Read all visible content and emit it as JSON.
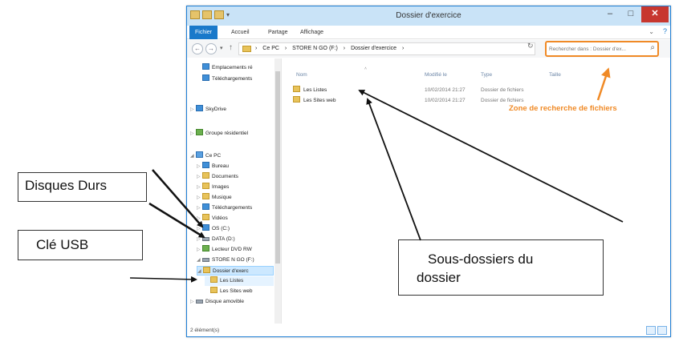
{
  "window": {
    "title": "Dossier d'exercice",
    "minimize": "–",
    "maximize": "□",
    "close": "✕"
  },
  "ribbon": {
    "tabs": [
      "Fichier",
      "Accueil",
      "Partage",
      "Affichage"
    ],
    "expand": "⌄",
    "help": "?"
  },
  "address": {
    "crumbs": [
      "›",
      "Ce PC",
      "›",
      "STORE N GO (F:)",
      "›",
      "Dossier d'exercice",
      "›"
    ],
    "dropdown": "⌄",
    "refresh": "↻"
  },
  "search": {
    "placeholder": "Rechercher dans : Dossier d'ex...",
    "icon": "search-icon"
  },
  "navpane": {
    "items": [
      {
        "label": "Emplacements ré",
        "icon": "folder-icon",
        "expander": ""
      },
      {
        "label": "Téléchargements",
        "icon": "download-folder-icon",
        "expander": ""
      },
      {
        "label": "SkyDrive",
        "icon": "cloud-icon",
        "expander": "▷"
      },
      {
        "label": "Groupe résidentiel",
        "icon": "homegroup-icon",
        "expander": "▷"
      },
      {
        "label": "Ce PC",
        "icon": "computer-icon",
        "expander": "◢"
      },
      {
        "label": "Bureau",
        "icon": "desktop-folder-icon",
        "expander": "▷"
      },
      {
        "label": "Documents",
        "icon": "documents-folder-icon",
        "expander": "▷"
      },
      {
        "label": "Images",
        "icon": "pictures-folder-icon",
        "expander": "▷"
      },
      {
        "label": "Musique",
        "icon": "music-folder-icon",
        "expander": "▷"
      },
      {
        "label": "Téléchargements",
        "icon": "download-folder-icon",
        "expander": "▷"
      },
      {
        "label": "Vidéos",
        "icon": "videos-folder-icon",
        "expander": "▷"
      },
      {
        "label": "OS (C:)",
        "icon": "drive-icon",
        "expander": "▷"
      },
      {
        "label": "DATA (D:)",
        "icon": "drive-icon",
        "expander": "▷"
      },
      {
        "label": "Lecteur DVD RW",
        "icon": "dvd-drive-icon",
        "expander": "▷"
      },
      {
        "label": "STORE N GO (F:)",
        "icon": "usb-drive-icon",
        "expander": "◢"
      },
      {
        "label": "Dossier d'exerc",
        "icon": "folder-icon",
        "expander": "◢"
      },
      {
        "label": "Les Listes",
        "icon": "folder-icon",
        "expander": ""
      },
      {
        "label": "Les Sites web",
        "icon": "folder-icon",
        "expander": ""
      },
      {
        "label": "Disque amovible",
        "icon": "removable-drive-icon",
        "expander": "▷"
      }
    ]
  },
  "columns": {
    "name": "Nom",
    "modified": "Modifié le",
    "type": "Type",
    "size": "Taille"
  },
  "files": [
    {
      "name": "Les Listes",
      "modified": "10/02/2014 21:27",
      "type": "Dossier de fichiers"
    },
    {
      "name": "Les Sites web",
      "modified": "10/02/2014 21:27",
      "type": "Dossier de fichiers"
    }
  ],
  "status": {
    "count": "2 élément(s)"
  },
  "annotations": {
    "disques_durs": "Disques Durs",
    "cle_usb": "Clé USB",
    "sous_dossiers_line1": "Sous-dossiers du",
    "sous_dossiers_line2": "dossier",
    "search_zone": "Zone de recherche de fichiers"
  },
  "colors": {
    "accent_orange": "#f08a26",
    "ribbon_blue": "#1979ca",
    "close_red": "#c7372f",
    "selection_blue": "#cce8ff"
  }
}
